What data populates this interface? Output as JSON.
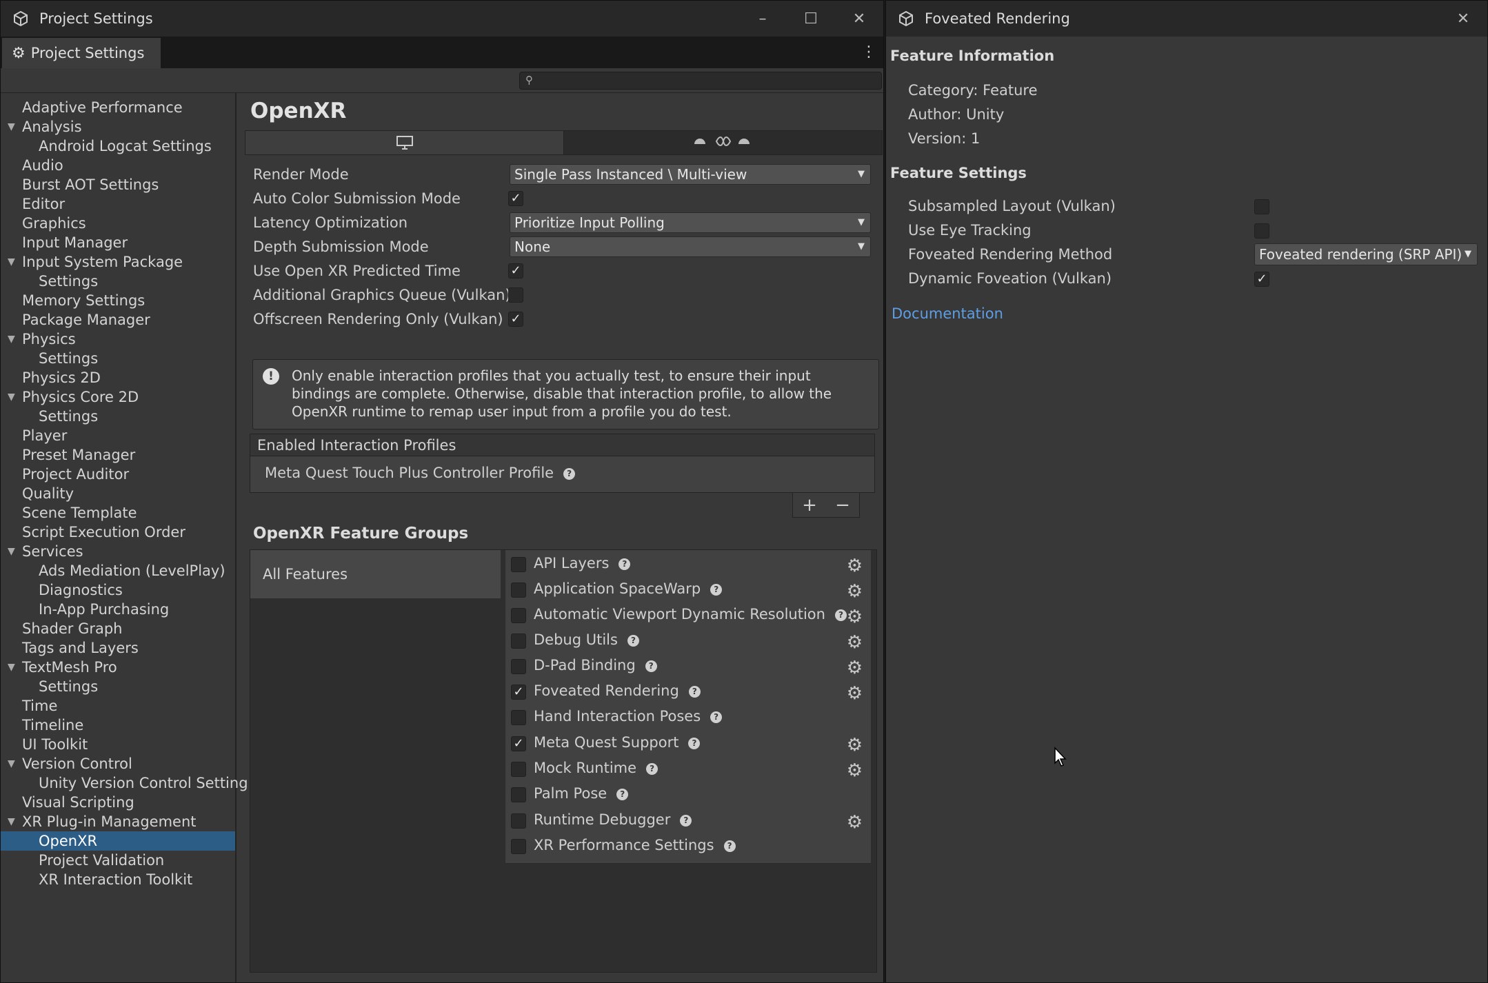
{
  "window1": {
    "title": "Project Settings",
    "tab_label": "Project Settings",
    "search_placeholder": ""
  },
  "sidebar": {
    "items": [
      {
        "label": "Adaptive Performance",
        "level": 0
      },
      {
        "label": "Analysis",
        "level": 0,
        "expanded": true
      },
      {
        "label": "Android Logcat Settings",
        "level": 1
      },
      {
        "label": "Audio",
        "level": 0
      },
      {
        "label": "Burst AOT Settings",
        "level": 0
      },
      {
        "label": "Editor",
        "level": 0
      },
      {
        "label": "Graphics",
        "level": 0
      },
      {
        "label": "Input Manager",
        "level": 0
      },
      {
        "label": "Input System Package",
        "level": 0,
        "expanded": true
      },
      {
        "label": "Settings",
        "level": 1
      },
      {
        "label": "Memory Settings",
        "level": 0
      },
      {
        "label": "Package Manager",
        "level": 0
      },
      {
        "label": "Physics",
        "level": 0,
        "expanded": true
      },
      {
        "label": "Settings",
        "level": 1
      },
      {
        "label": "Physics 2D",
        "level": 0
      },
      {
        "label": "Physics Core 2D",
        "level": 0,
        "expanded": true
      },
      {
        "label": "Settings",
        "level": 1
      },
      {
        "label": "Player",
        "level": 0
      },
      {
        "label": "Preset Manager",
        "level": 0
      },
      {
        "label": "Project Auditor",
        "level": 0
      },
      {
        "label": "Quality",
        "level": 0
      },
      {
        "label": "Scene Template",
        "level": 0
      },
      {
        "label": "Script Execution Order",
        "level": 0
      },
      {
        "label": "Services",
        "level": 0,
        "expanded": true
      },
      {
        "label": "Ads Mediation (LevelPlay)",
        "level": 1
      },
      {
        "label": "Diagnostics",
        "level": 1
      },
      {
        "label": "In-App Purchasing",
        "level": 1
      },
      {
        "label": "Shader Graph",
        "level": 0
      },
      {
        "label": "Tags and Layers",
        "level": 0
      },
      {
        "label": "TextMesh Pro",
        "level": 0,
        "expanded": true
      },
      {
        "label": "Settings",
        "level": 1
      },
      {
        "label": "Time",
        "level": 0
      },
      {
        "label": "Timeline",
        "level": 0
      },
      {
        "label": "UI Toolkit",
        "level": 0
      },
      {
        "label": "Version Control",
        "level": 0,
        "expanded": true
      },
      {
        "label": "Unity Version Control Setting",
        "level": 1
      },
      {
        "label": "Visual Scripting",
        "level": 0
      },
      {
        "label": "XR Plug-in Management",
        "level": 0,
        "expanded": true
      },
      {
        "label": "OpenXR",
        "level": 1,
        "selected": true
      },
      {
        "label": "Project Validation",
        "level": 1
      },
      {
        "label": "XR Interaction Toolkit",
        "level": 1
      }
    ]
  },
  "main": {
    "title": "OpenXR",
    "platform_tabs": [
      "desktop-icon",
      "android-meta-icon"
    ],
    "settings": {
      "render_mode_label": "Render Mode",
      "render_mode_value": "Single Pass Instanced \\ Multi-view",
      "auto_color_label": "Auto Color Submission Mode",
      "auto_color_checked": true,
      "latency_label": "Latency Optimization",
      "latency_value": "Prioritize Input Polling",
      "depth_label": "Depth Submission Mode",
      "depth_value": "None",
      "predicted_time_label": "Use Open XR Predicted Time",
      "predicted_time_checked": true,
      "graphics_queue_label": "Additional Graphics Queue (Vulkan)",
      "graphics_queue_checked": false,
      "offscreen_label": "Offscreen Rendering Only (Vulkan)",
      "offscreen_checked": true
    },
    "help_text": "Only enable interaction profiles that you actually test, to ensure their input bindings are complete. Otherwise, disable that interaction profile, to allow the OpenXR runtime to remap user input from a profile you do test.",
    "profiles_header": "Enabled Interaction Profiles",
    "profile_item": "Meta Quest Touch Plus Controller Profile",
    "add_label": "+",
    "remove_label": "−",
    "feature_groups_title": "OpenXR Feature Groups",
    "all_features": "All Features",
    "features": [
      {
        "label": "API Layers",
        "checked": false,
        "gear": true
      },
      {
        "label": "Application SpaceWarp",
        "checked": false,
        "gear": true
      },
      {
        "label": "Automatic Viewport Dynamic Resolution",
        "checked": false,
        "gear": true
      },
      {
        "label": "Debug Utils",
        "checked": false,
        "gear": true
      },
      {
        "label": "D-Pad Binding",
        "checked": false,
        "gear": true
      },
      {
        "label": "Foveated Rendering",
        "checked": true,
        "gear": true
      },
      {
        "label": "Hand Interaction Poses",
        "checked": false,
        "gear": false
      },
      {
        "label": "Meta Quest Support",
        "checked": true,
        "gear": true
      },
      {
        "label": "Mock Runtime",
        "checked": false,
        "gear": true
      },
      {
        "label": "Palm Pose",
        "checked": false,
        "gear": false
      },
      {
        "label": "Runtime Debugger",
        "checked": false,
        "gear": true
      },
      {
        "label": "XR Performance Settings",
        "checked": false,
        "gear": false
      }
    ]
  },
  "window2": {
    "title": "Foveated Rendering",
    "feature_info_header": "Feature Information",
    "category": "Category: Feature",
    "author": "Author: Unity",
    "version": "Version: 1",
    "feature_settings_header": "Feature Settings",
    "subsampled_label": "Subsampled Layout (Vulkan)",
    "subsampled_checked": false,
    "eye_tracking_label": "Use Eye Tracking",
    "eye_tracking_checked": false,
    "method_label": "Foveated Rendering Method",
    "method_value": "Foveated rendering (SRP API)",
    "dynamic_label": "Dynamic Foveation (Vulkan)",
    "dynamic_checked": true,
    "documentation_link": "Documentation"
  },
  "colors": {
    "window_bg": "#383838",
    "titlebar_bg": "#282828",
    "selection": "#2c5d87",
    "link": "#5d9ee4"
  }
}
